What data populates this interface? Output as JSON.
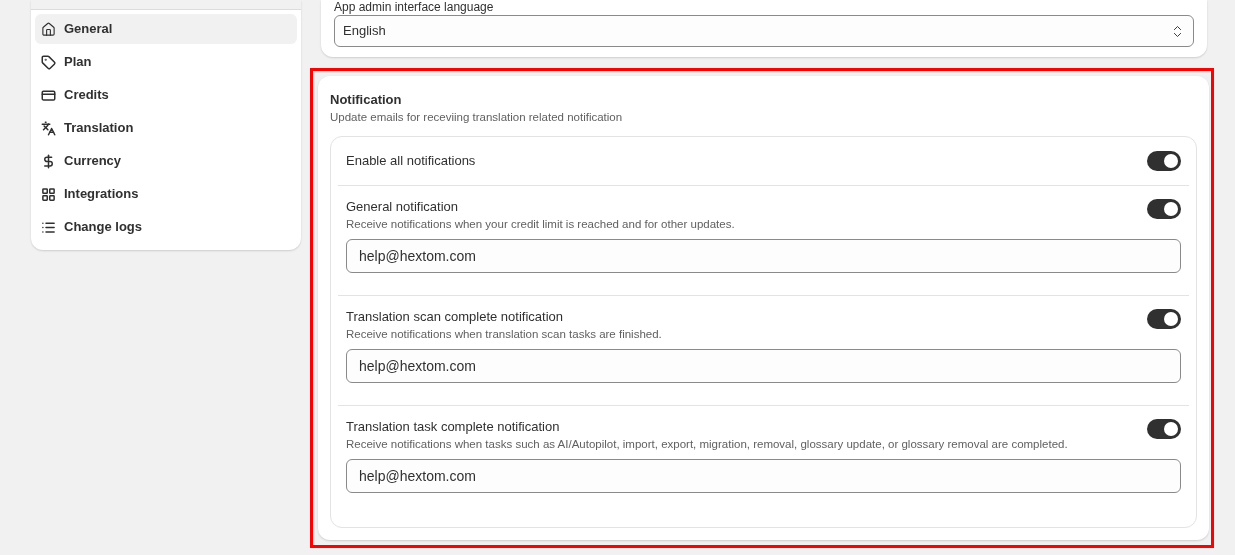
{
  "sidebar": {
    "items": [
      {
        "label": "General",
        "selected": true
      },
      {
        "label": "Plan",
        "selected": false
      },
      {
        "label": "Credits",
        "selected": false
      },
      {
        "label": "Translation",
        "selected": false
      },
      {
        "label": "Currency",
        "selected": false
      },
      {
        "label": "Integrations",
        "selected": false
      },
      {
        "label": "Change logs",
        "selected": false
      }
    ]
  },
  "language": {
    "label": "App admin interface language",
    "value": "English"
  },
  "notification": {
    "title": "Notification",
    "subtitle": "Update emails for receviing translation related notification",
    "enable_all": {
      "label": "Enable all notifications",
      "on": true
    },
    "items": [
      {
        "title": "General notification",
        "description": "Receive notifications when your credit limit is reached and for other updates.",
        "on": true,
        "email": "help@hextom.com"
      },
      {
        "title": "Translation scan complete notification",
        "description": "Receive notifications when translation scan tasks are finished.",
        "on": true,
        "email": "help@hextom.com"
      },
      {
        "title": "Translation task complete notification",
        "description": "Receive notifications when tasks such as AI/Autopilot, import, export, migration, removal, glossary update, or glossary removal are completed.",
        "on": true,
        "email": "help@hextom.com"
      }
    ]
  }
}
